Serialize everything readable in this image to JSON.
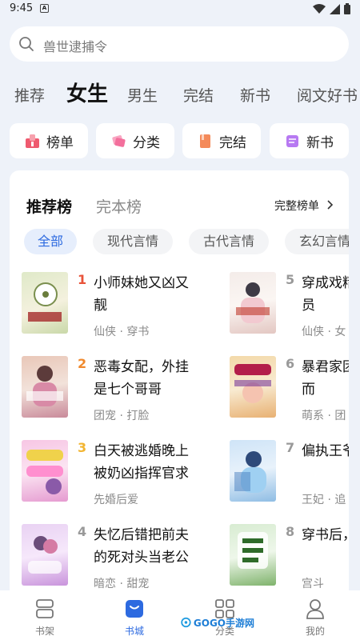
{
  "status": {
    "time": "9:45",
    "notif_glyph": "A"
  },
  "search": {
    "placeholder": "兽世逮捕令"
  },
  "tabs": [
    "推荐",
    "女生",
    "男生",
    "完结",
    "新书",
    "阅文好书"
  ],
  "quick_links": [
    {
      "label": "榜单",
      "icon": "chart-icon",
      "color": "#ef5a6f"
    },
    {
      "label": "分类",
      "icon": "category-icon",
      "color": "#f36f9c"
    },
    {
      "label": "完结",
      "icon": "book-icon",
      "color": "#f48a5a"
    },
    {
      "label": "新书",
      "icon": "newbook-icon",
      "color": "#b779f2"
    }
  ],
  "rank": {
    "tabs": [
      "推荐榜",
      "完本榜"
    ],
    "full_list": "完整榜单",
    "chips": [
      "全部",
      "现代言情",
      "古代言情",
      "玄幻言情"
    ]
  },
  "books": [
    {
      "rank": "1",
      "title": "小师妹她又凶又靓",
      "tags": "仙侠 · 穿书"
    },
    {
      "rank": "2",
      "title": "恶毒女配，外挂是七个哥哥",
      "tags": "团宠 · 打脸"
    },
    {
      "rank": "3",
      "title": "白天被逃婚晚上被奶凶指挥官求",
      "tags": "先婚后爱"
    },
    {
      "rank": "4",
      "title": "失忆后错把前夫的死对头当老公",
      "tags": "暗恋 · 甜宠"
    },
    {
      "rank": "5",
      "title": "穿成戏精妹，全员",
      "tags": "仙侠 · 女"
    },
    {
      "rank": "6",
      "title": "暴君家团她恃宠而",
      "tags": "萌系 · 团"
    },
    {
      "rank": "7",
      "title": "偏执王爷医妃",
      "tags": "王妃 · 追"
    },
    {
      "rank": "8",
      "title": "穿书后，妃又剧",
      "tags": "宫斗"
    }
  ],
  "bottom_nav": [
    {
      "label": "书架",
      "icon": "bookshelf-icon"
    },
    {
      "label": "书城",
      "icon": "bookstore-icon"
    },
    {
      "label": "分类",
      "icon": "category-grid-icon"
    },
    {
      "label": "我的",
      "icon": "profile-icon"
    }
  ],
  "watermark": {
    "text": "GOGO手游网"
  },
  "colors": {
    "accent": "#2d6ae0",
    "background": "#eef2f9",
    "rank1": "#e8533a",
    "rank2": "#f0892d",
    "rank3": "#f2b532"
  }
}
